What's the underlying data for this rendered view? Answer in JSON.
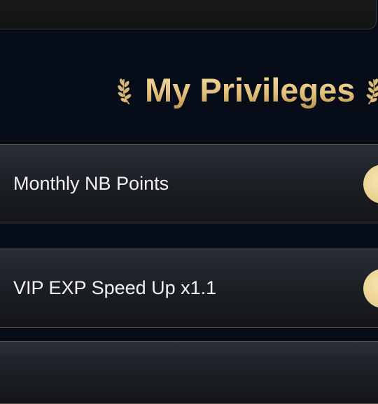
{
  "header": {
    "title": "My Privileges",
    "decoration_icon": "laurel-wreath-icon"
  },
  "privileges": [
    {
      "label": "Monthly NB Points",
      "icon": "gold-coin-icon"
    },
    {
      "label": "VIP EXP Speed Up x1.1",
      "icon": "gold-coin-icon"
    },
    {
      "label": "",
      "icon": ""
    }
  ],
  "colors": {
    "background": "#060d19",
    "title_gold": "#e6c684",
    "card_border": "#5a5448",
    "coin_gold": "#e9d18f",
    "label_text": "#f2f2f2"
  }
}
